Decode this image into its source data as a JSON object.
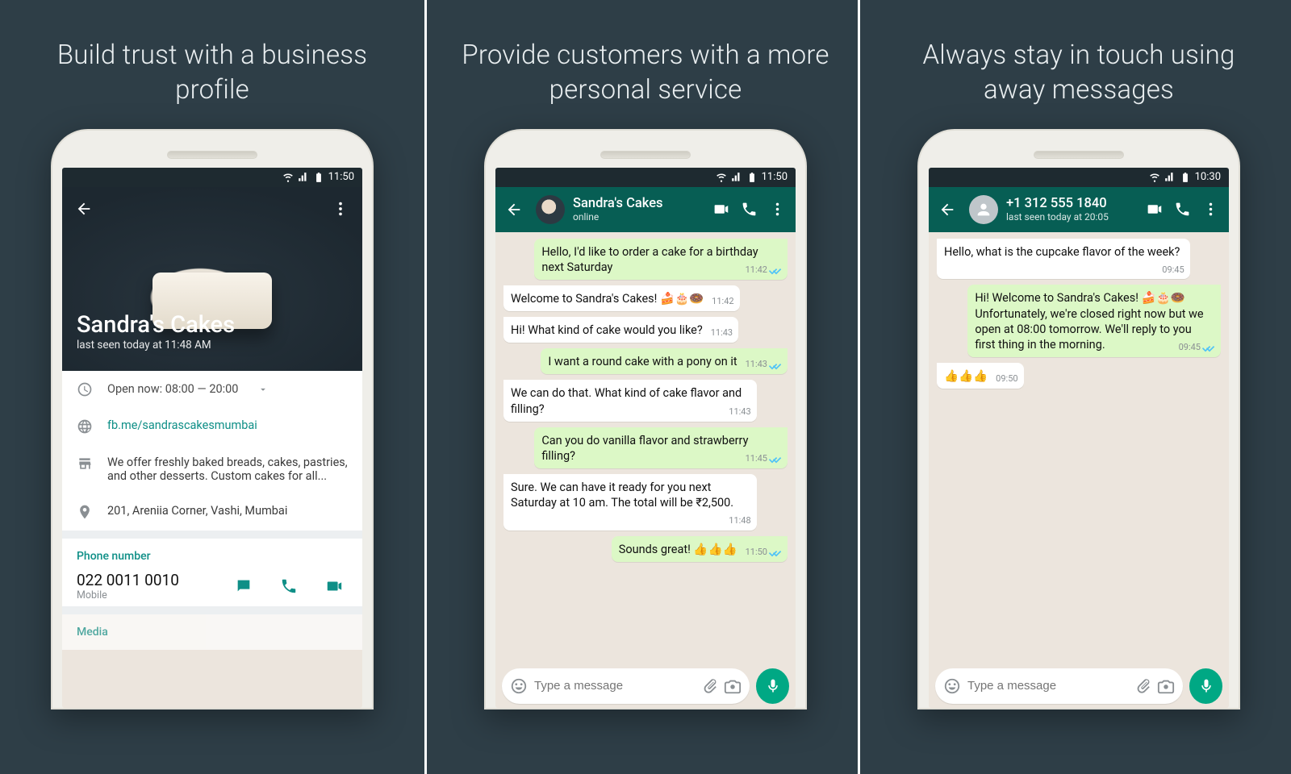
{
  "headlines": {
    "p1": "Build trust with a business profile",
    "p2": "Provide customers with a more personal service",
    "p3": "Always stay in touch using away messages"
  },
  "colors": {
    "teal": "#075e54",
    "accent": "#00a884",
    "chatBg": "#ece5dd"
  },
  "p1": {
    "status_time": "11:50",
    "profile_name": "Sandra's Cakes",
    "last_seen": "last seen today at 11:48 AM",
    "hours": "Open now: 08:00 — 20:00",
    "link": "fb.me/sandrascakesmumbai",
    "description": "We offer freshly baked breads, cakes, pastries, and other desserts. Custom cakes for all...",
    "address": "201, Areniia Corner, Vashi, Mumbai",
    "phone_label": "Phone number",
    "phone_number": "022 0011 0010",
    "phone_type": "Mobile",
    "media_label": "Media"
  },
  "p2": {
    "status_time": "11:50",
    "chat_name": "Sandra's Cakes",
    "chat_sub": "online",
    "input_placeholder": "Type a message",
    "messages": [
      {
        "dir": "out",
        "text": "Hello, I'd like to order a cake for a birthday next Saturday",
        "time": "11:42",
        "ticks": true
      },
      {
        "dir": "in",
        "text": "Welcome to Sandra's Cakes! 🍰🎂🍩",
        "time": "11:42"
      },
      {
        "dir": "in",
        "text": "Hi! What kind of cake would you like?",
        "time": "11:43"
      },
      {
        "dir": "out",
        "text": "I want a round cake with a pony on it",
        "time": "11:43",
        "ticks": true
      },
      {
        "dir": "in",
        "text": "We can do that. What kind of cake flavor and filling?",
        "time": "11:43"
      },
      {
        "dir": "out",
        "text": "Can you do vanilla flavor and strawberry filling?",
        "time": "11:45",
        "ticks": true
      },
      {
        "dir": "in",
        "text": "Sure. We can have it ready for you next Saturday at 10 am. The total will be ₹2,500.",
        "time": "11:48"
      },
      {
        "dir": "out",
        "text": "Sounds great! 👍👍👍",
        "time": "11:50",
        "ticks": true
      }
    ]
  },
  "p3": {
    "status_time": "10:30",
    "chat_name": "+1 312 555 1840",
    "chat_sub": "last seen today at 20:05",
    "input_placeholder": "Type a message",
    "messages": [
      {
        "dir": "in",
        "text": "Hello, what is the cupcake flavor of the week?",
        "time": "09:45"
      },
      {
        "dir": "out",
        "text": "Hi! Welcome to Sandra's Cakes! 🍰🎂🍩\nUnfortunately, we're closed right now but we open at 08:00 tomorrow. We'll reply to you first thing in the morning.",
        "time": "09:45",
        "ticks": true
      },
      {
        "dir": "in",
        "text": "👍👍👍",
        "time": "09:50"
      }
    ]
  }
}
